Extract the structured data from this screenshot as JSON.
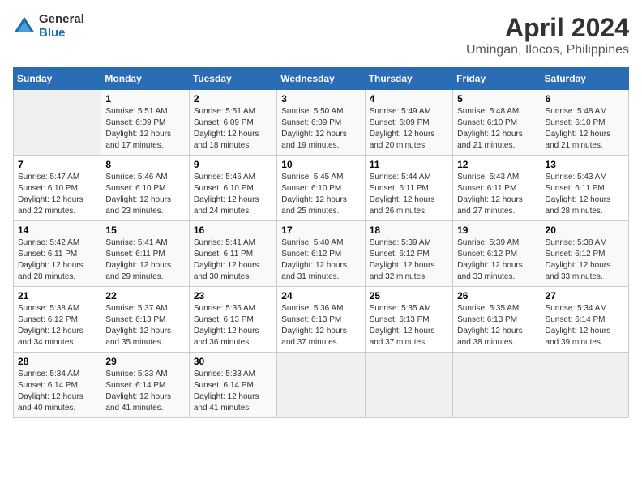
{
  "logo": {
    "general": "General",
    "blue": "Blue"
  },
  "title": "April 2024",
  "location": "Umingan, Ilocos, Philippines",
  "weekdays": [
    "Sunday",
    "Monday",
    "Tuesday",
    "Wednesday",
    "Thursday",
    "Friday",
    "Saturday"
  ],
  "weeks": [
    [
      {
        "day": "",
        "info": ""
      },
      {
        "day": "1",
        "info": "Sunrise: 5:51 AM\nSunset: 6:09 PM\nDaylight: 12 hours\nand 17 minutes."
      },
      {
        "day": "2",
        "info": "Sunrise: 5:51 AM\nSunset: 6:09 PM\nDaylight: 12 hours\nand 18 minutes."
      },
      {
        "day": "3",
        "info": "Sunrise: 5:50 AM\nSunset: 6:09 PM\nDaylight: 12 hours\nand 19 minutes."
      },
      {
        "day": "4",
        "info": "Sunrise: 5:49 AM\nSunset: 6:09 PM\nDaylight: 12 hours\nand 20 minutes."
      },
      {
        "day": "5",
        "info": "Sunrise: 5:48 AM\nSunset: 6:10 PM\nDaylight: 12 hours\nand 21 minutes."
      },
      {
        "day": "6",
        "info": "Sunrise: 5:48 AM\nSunset: 6:10 PM\nDaylight: 12 hours\nand 21 minutes."
      }
    ],
    [
      {
        "day": "7",
        "info": "Sunrise: 5:47 AM\nSunset: 6:10 PM\nDaylight: 12 hours\nand 22 minutes."
      },
      {
        "day": "8",
        "info": "Sunrise: 5:46 AM\nSunset: 6:10 PM\nDaylight: 12 hours\nand 23 minutes."
      },
      {
        "day": "9",
        "info": "Sunrise: 5:46 AM\nSunset: 6:10 PM\nDaylight: 12 hours\nand 24 minutes."
      },
      {
        "day": "10",
        "info": "Sunrise: 5:45 AM\nSunset: 6:10 PM\nDaylight: 12 hours\nand 25 minutes."
      },
      {
        "day": "11",
        "info": "Sunrise: 5:44 AM\nSunset: 6:11 PM\nDaylight: 12 hours\nand 26 minutes."
      },
      {
        "day": "12",
        "info": "Sunrise: 5:43 AM\nSunset: 6:11 PM\nDaylight: 12 hours\nand 27 minutes."
      },
      {
        "day": "13",
        "info": "Sunrise: 5:43 AM\nSunset: 6:11 PM\nDaylight: 12 hours\nand 28 minutes."
      }
    ],
    [
      {
        "day": "14",
        "info": "Sunrise: 5:42 AM\nSunset: 6:11 PM\nDaylight: 12 hours\nand 28 minutes."
      },
      {
        "day": "15",
        "info": "Sunrise: 5:41 AM\nSunset: 6:11 PM\nDaylight: 12 hours\nand 29 minutes."
      },
      {
        "day": "16",
        "info": "Sunrise: 5:41 AM\nSunset: 6:11 PM\nDaylight: 12 hours\nand 30 minutes."
      },
      {
        "day": "17",
        "info": "Sunrise: 5:40 AM\nSunset: 6:12 PM\nDaylight: 12 hours\nand 31 minutes."
      },
      {
        "day": "18",
        "info": "Sunrise: 5:39 AM\nSunset: 6:12 PM\nDaylight: 12 hours\nand 32 minutes."
      },
      {
        "day": "19",
        "info": "Sunrise: 5:39 AM\nSunset: 6:12 PM\nDaylight: 12 hours\nand 33 minutes."
      },
      {
        "day": "20",
        "info": "Sunrise: 5:38 AM\nSunset: 6:12 PM\nDaylight: 12 hours\nand 33 minutes."
      }
    ],
    [
      {
        "day": "21",
        "info": "Sunrise: 5:38 AM\nSunset: 6:12 PM\nDaylight: 12 hours\nand 34 minutes."
      },
      {
        "day": "22",
        "info": "Sunrise: 5:37 AM\nSunset: 6:13 PM\nDaylight: 12 hours\nand 35 minutes."
      },
      {
        "day": "23",
        "info": "Sunrise: 5:36 AM\nSunset: 6:13 PM\nDaylight: 12 hours\nand 36 minutes."
      },
      {
        "day": "24",
        "info": "Sunrise: 5:36 AM\nSunset: 6:13 PM\nDaylight: 12 hours\nand 37 minutes."
      },
      {
        "day": "25",
        "info": "Sunrise: 5:35 AM\nSunset: 6:13 PM\nDaylight: 12 hours\nand 37 minutes."
      },
      {
        "day": "26",
        "info": "Sunrise: 5:35 AM\nSunset: 6:13 PM\nDaylight: 12 hours\nand 38 minutes."
      },
      {
        "day": "27",
        "info": "Sunrise: 5:34 AM\nSunset: 6:14 PM\nDaylight: 12 hours\nand 39 minutes."
      }
    ],
    [
      {
        "day": "28",
        "info": "Sunrise: 5:34 AM\nSunset: 6:14 PM\nDaylight: 12 hours\nand 40 minutes."
      },
      {
        "day": "29",
        "info": "Sunrise: 5:33 AM\nSunset: 6:14 PM\nDaylight: 12 hours\nand 41 minutes."
      },
      {
        "day": "30",
        "info": "Sunrise: 5:33 AM\nSunset: 6:14 PM\nDaylight: 12 hours\nand 41 minutes."
      },
      {
        "day": "",
        "info": ""
      },
      {
        "day": "",
        "info": ""
      },
      {
        "day": "",
        "info": ""
      },
      {
        "day": "",
        "info": ""
      }
    ]
  ]
}
